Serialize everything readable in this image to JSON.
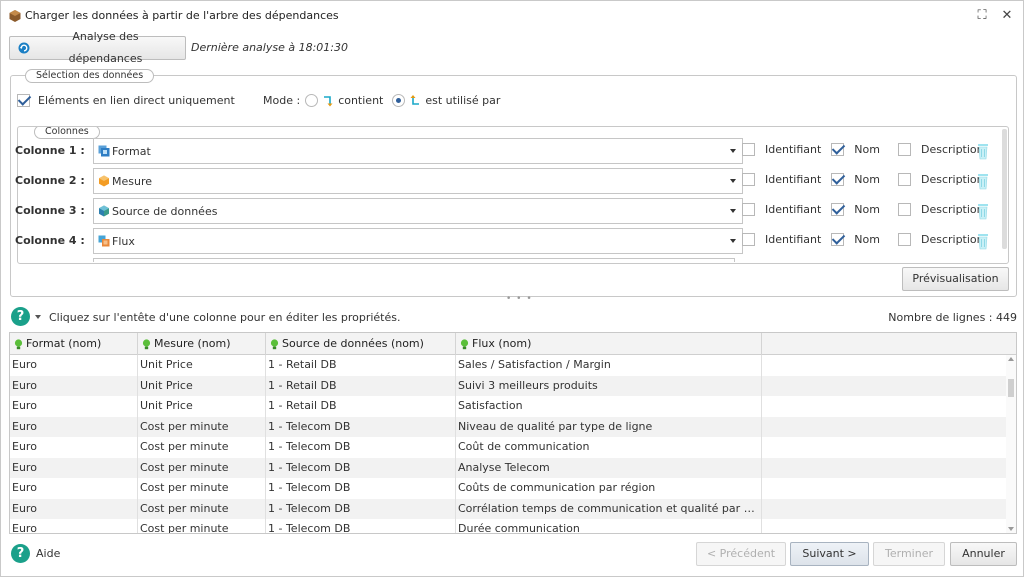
{
  "window": {
    "title": "Charger les données à partir de l'arbre des dépendances",
    "maximize_glyph": "⛶",
    "close_glyph": "✕"
  },
  "analysis": {
    "button_label": "Analyse des dépendances",
    "last_analysis": "Dernière analyse à 18:01:30"
  },
  "selection": {
    "legend": "Sélection des données",
    "direct_only_label": "Eléments en lien direct uniquement",
    "direct_only_checked": true,
    "mode_label": "Mode :",
    "mode_contains_label": "contient",
    "mode_used_by_label": "est utilisé par",
    "selected_mode": "est utilisé par"
  },
  "columns": {
    "legend": "Colonnes",
    "option_labels": {
      "identifier": "Identifiant",
      "name": "Nom",
      "description": "Description"
    },
    "items": [
      {
        "label": "Colonne 1 :",
        "value": "Format",
        "icon": "format-icon",
        "identifier": false,
        "name": true,
        "description": false
      },
      {
        "label": "Colonne 2 :",
        "value": "Mesure",
        "icon": "measure-icon",
        "identifier": false,
        "name": true,
        "description": false
      },
      {
        "label": "Colonne 3 :",
        "value": "Source de données",
        "icon": "datasource-icon",
        "identifier": false,
        "name": true,
        "description": false
      },
      {
        "label": "Colonne 4 :",
        "value": "Flux",
        "icon": "flow-icon",
        "identifier": false,
        "name": true,
        "description": false
      }
    ],
    "preview_button": "Prévisualisation"
  },
  "grid_info": {
    "hint": "Cliquez sur l'entête d'une colonne pour en éditer les propriétés.",
    "row_count": "Nombre de lignes : 449"
  },
  "grid": {
    "headers": [
      "Format (nom)",
      "Mesure (nom)",
      "Source de données (nom)",
      "Flux (nom)"
    ],
    "rows": [
      [
        "Euro",
        "Unit Price",
        "1 - Retail DB",
        "Sales / Satisfaction / Margin"
      ],
      [
        "Euro",
        "Unit Price",
        "1 - Retail DB",
        "Suivi 3 meilleurs produits"
      ],
      [
        "Euro",
        "Unit Price",
        "1 - Retail DB",
        "Satisfaction"
      ],
      [
        "Euro",
        "Cost per minute",
        "1 - Telecom DB",
        "Niveau de qualité par type de ligne"
      ],
      [
        "Euro",
        "Cost per minute",
        "1 - Telecom DB",
        "Coût de communication"
      ],
      [
        "Euro",
        "Cost per minute",
        "1 - Telecom DB",
        "Analyse Telecom"
      ],
      [
        "Euro",
        "Cost per minute",
        "1 - Telecom DB",
        "Coûts de communication par région"
      ],
      [
        "Euro",
        "Cost per minute",
        "1 - Telecom DB",
        "Corrélation temps de communication et qualité par matériel"
      ],
      [
        "Euro",
        "Cost per minute",
        "1 - Telecom DB",
        "Durée communication"
      ]
    ]
  },
  "footer": {
    "help_label": "Aide",
    "previous": "< Précédent",
    "next": "Suivant >",
    "finish": "Terminer",
    "cancel": "Annuler"
  },
  "colors": {
    "accent": "#2f5f9a",
    "help_green": "#1aa08a",
    "border": "#c8c8c8",
    "row_alt": "#f2f2f2"
  }
}
